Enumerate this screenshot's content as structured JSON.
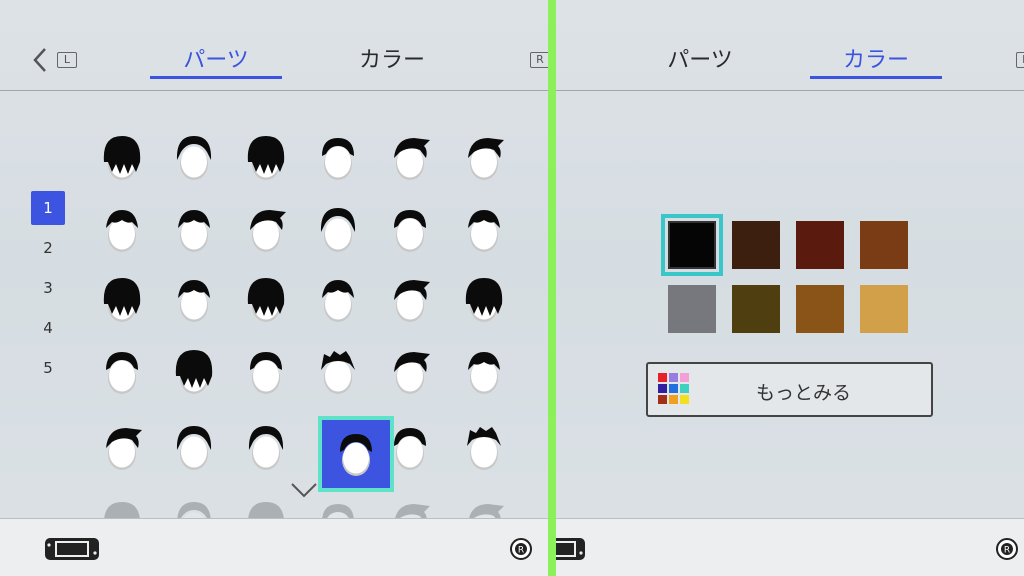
{
  "left": {
    "tabs": [
      {
        "label": "パーツ",
        "active": true
      },
      {
        "label": "カラー",
        "active": false
      }
    ],
    "shoulder_left": "L",
    "shoulder_right": "R",
    "pages": [
      "1",
      "2",
      "3",
      "4",
      "5"
    ],
    "active_page": "1",
    "hair_rows": [
      [
        "hair-style-short-bowl",
        "hair-style-short-center",
        "hair-style-short-round",
        "hair-style-short-spiky-top",
        "hair-style-long-fringe",
        "hair-style-side-sweep"
      ],
      [
        "hair-style-side-part",
        "hair-style-side-flip",
        "hair-style-neat",
        "hair-style-swoop",
        "hair-style-center-part",
        "hair-style-tuft"
      ],
      [
        "hair-style-buzz",
        "hair-style-bob-bangs",
        "hair-style-helmet",
        "hair-style-crew",
        "hair-style-spiky-front",
        "hair-style-wild-spiky"
      ],
      [
        "hair-style-messy",
        "hair-style-messy-side",
        "hair-style-curly-side",
        "hair-style-tousled",
        "hair-style-fluffy",
        "hair-style-tousled-2"
      ],
      [
        "hair-style-afro",
        "hair-style-long-side",
        "hair-style-long-bob",
        "hair-style-curly-top",
        "hair-style-long-straight",
        "hair-style-long-full"
      ]
    ],
    "selected_hair": "hair-style-curly-top"
  },
  "right": {
    "tabs": [
      {
        "label": "パーツ",
        "active": false
      },
      {
        "label": "カラー",
        "active": true
      }
    ],
    "shoulder_right": "R",
    "swatches": [
      "#050505",
      "#3c1f0e",
      "#5a1a0e",
      "#7a3c14",
      "#77787d",
      "#4e3e10",
      "#8a5418",
      "#d3a04a"
    ],
    "selected_swatch_index": 0,
    "more_button_label": "もっとみる",
    "palette_icon_colors": [
      "#e8202a",
      "#9a7be0",
      "#f4a0d8",
      "#3020a0",
      "#2070e0",
      "#40d0c0",
      "#a03018",
      "#f0a020",
      "#f0e020"
    ]
  },
  "footer": {
    "device_icon": "handheld-console-icon",
    "stick_icon": "right-stick-icon"
  }
}
